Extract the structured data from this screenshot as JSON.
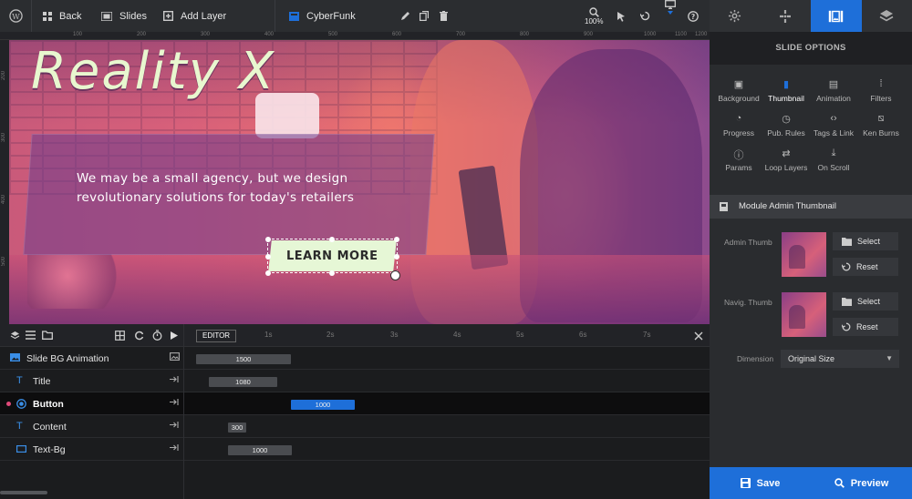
{
  "toolbar": {
    "back_label": "Back",
    "slides_label": "Slides",
    "add_layer_label": "Add Layer",
    "slider_name": "CyberFunk",
    "zoom_label": "100%"
  },
  "ruler": {
    "top_ticks": [
      "100",
      "200",
      "300",
      "400",
      "500",
      "600",
      "700",
      "800",
      "900",
      "1000",
      "1100",
      "1200"
    ],
    "left_ticks": [
      "200",
      "300",
      "400",
      "500"
    ]
  },
  "canvas": {
    "title": "Reality X",
    "content": "We may be a small agency, but we design revolutionary solutions for today's retailers",
    "button_text": "LEARN MORE"
  },
  "timeline": {
    "editor_label": "EDITOR",
    "ticks": [
      "1s",
      "2s",
      "3s",
      "4s",
      "5s",
      "6s",
      "7s"
    ],
    "rows": [
      {
        "label": "Slide BG Animation",
        "duration": "1500",
        "icon": "image-icon"
      },
      {
        "label": "Title",
        "duration": "1080",
        "icon": "text-icon"
      },
      {
        "label": "Button",
        "duration": "1000",
        "icon": "button-icon",
        "selected": true
      },
      {
        "label": "Content",
        "duration": "300",
        "icon": "text-icon"
      },
      {
        "label": "Text-Bg",
        "duration": "1000",
        "icon": "shape-icon"
      }
    ]
  },
  "panel": {
    "header": "SLIDE OPTIONS",
    "options": [
      "Background",
      "Thumbnail",
      "Animation",
      "Filters",
      "Progress",
      "Pub. Rules",
      "Tags & Link",
      "Ken Burns",
      "Params",
      "Loop Layers",
      "On Scroll"
    ],
    "active_option": "Thumbnail",
    "module_title": "Module Admin Thumbnail",
    "admin_thumb_label": "Admin Thumb",
    "navig_thumb_label": "Navig. Thumb",
    "select_label": "Select",
    "reset_label": "Reset",
    "dimension_label": "Dimension",
    "dimension_value": "Original Size",
    "save_label": "Save",
    "preview_label": "Preview"
  },
  "colors": {
    "accent": "#1e6fd9",
    "cta_bg": "#e6f7d6",
    "title_color": "#e8f7cf"
  }
}
